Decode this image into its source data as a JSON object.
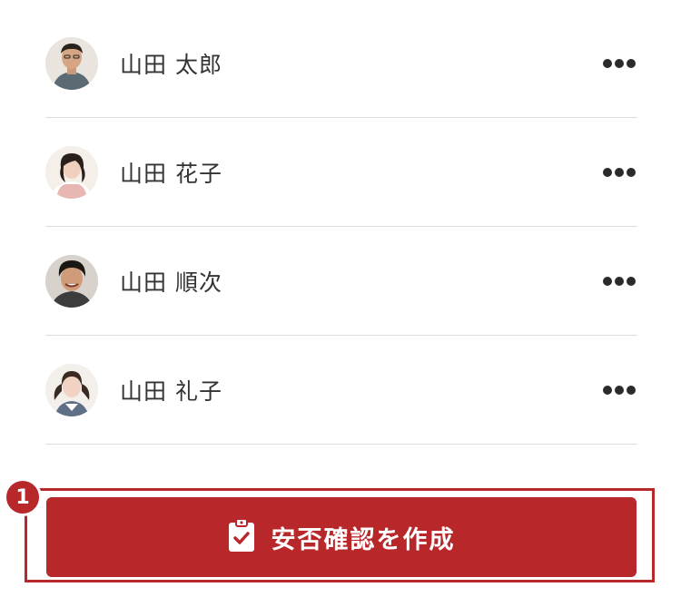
{
  "members": [
    {
      "name": "山田 太郎",
      "avatar": "avatar-man-glasses"
    },
    {
      "name": "山田 花子",
      "avatar": "avatar-woman-ponytail"
    },
    {
      "name": "山田 順次",
      "avatar": "avatar-young-man"
    },
    {
      "name": "山田 礼子",
      "avatar": "avatar-girl-pigtails"
    }
  ],
  "more_icon": "ellipsis-icon",
  "step_badge": "1",
  "create_button": {
    "label": "安否確認を作成",
    "icon": "clipboard-check-icon"
  },
  "colors": {
    "accent": "#b8282b",
    "text": "#333333",
    "divider": "#dcdcdc",
    "icon_dark": "#2b2b2b"
  }
}
